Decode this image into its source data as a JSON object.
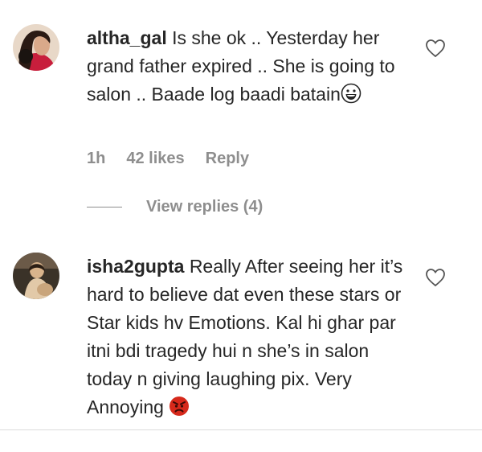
{
  "comments": [
    {
      "username": "altha_gal",
      "text": "Is she ok .. Yesterday her grand father expired .. She is going to salon .. Baade log baadi batain",
      "emoji": "grinning-face-icon",
      "time": "1h",
      "likes": "42 likes",
      "reply_label": "Reply",
      "view_replies": "View replies (4)"
    },
    {
      "username": "isha2gupta",
      "text": "Really After seeing her it’s hard to believe dat even these stars or Star kids hv Emotions. Kal hi ghar par itni bdi tragedy hui n she’s in salon today n giving laughing pix. Very Annoying",
      "emoji": "angry-face-icon"
    }
  ],
  "colors": {
    "text": "#262626",
    "meta": "#8e8e8e",
    "divider": "#dbdbdb"
  }
}
